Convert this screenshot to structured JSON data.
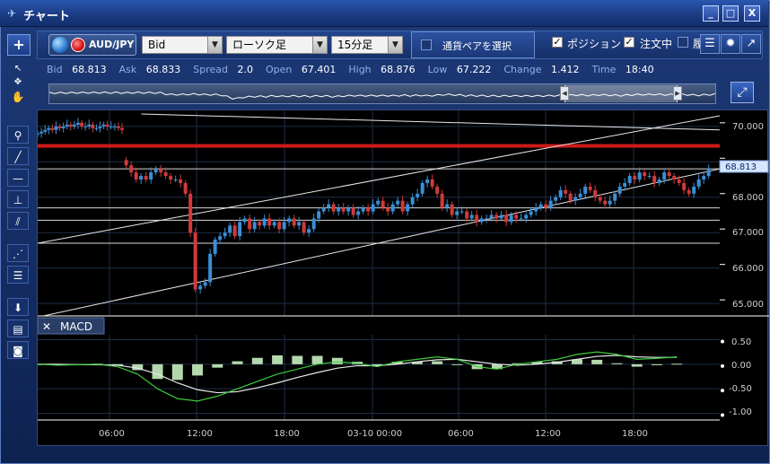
{
  "window": {
    "title": "チャート",
    "minimize_glyph": "_",
    "maximize_glyph": "□",
    "close_glyph": "X"
  },
  "toolbar": {
    "add_glyph": "+",
    "pair": "AUD/JPY",
    "price_type": "Bid",
    "chart_type": "ローソク足",
    "timeframe": "15分足",
    "pair_select_label": "通貨ペアを選択",
    "position_label": "ポジション",
    "position_checked": true,
    "orders_label": "注文中",
    "orders_checked": true,
    "history_label": "履",
    "history_checked": false
  },
  "quote": {
    "bid_label": "Bid",
    "bid": "68.813",
    "ask_label": "Ask",
    "ask": "68.833",
    "spread_label": "Spread",
    "spread": "2.0",
    "open_label": "Open",
    "open": "67.401",
    "high_label": "High",
    "high": "68.876",
    "low_label": "Low",
    "low": "67.222",
    "change_label": "Change",
    "change": "1.412",
    "time_label": "Time",
    "time": "18:40"
  },
  "colors": {
    "up": "#3a8fd6",
    "down": "#d03a3a",
    "resistance": "#cc1a1a",
    "price_label_bg": "#d6e6ff",
    "macd_line": "#3ecb3e",
    "signal_line": "#e8e8e8",
    "histogram": "#c8f0c0"
  },
  "price_axis": {
    "current_price": "68.813",
    "ticks": [
      "70.000",
      "69.000",
      "68.000",
      "67.000",
      "66.000",
      "65.000"
    ]
  },
  "macd": {
    "title": "MACD",
    "close_glyph": "✕",
    "ticks": [
      "0.50",
      "0.00",
      "-0.50",
      "-1.00"
    ]
  },
  "time_axis": {
    "ticks": [
      "06:00",
      "12:00",
      "18:00",
      "03-10 00:00",
      "06:00",
      "12:00",
      "18:00"
    ]
  },
  "chart_data": {
    "type": "candlestick",
    "pair": "AUD/JPY",
    "timeframe": "15分足",
    "price_range": [
      64.8,
      70.3
    ],
    "macd_range": [
      -1.1,
      0.6
    ],
    "time_ticks": [
      "06:00",
      "12:00",
      "18:00",
      "03-10 00:00",
      "06:00",
      "12:00",
      "18:00"
    ],
    "resistance_level": 69.45,
    "horizontal_levels": [
      68.8,
      67.7,
      67.35,
      66.7
    ],
    "channel_support": [
      [
        0.45,
        64.65
      ],
      [
        49.3,
        68.8
      ]
    ],
    "channel_resistance": [
      [
        0.0,
        66.7
      ],
      [
        49.3,
        70.3
      ]
    ],
    "trendline_top": [
      [
        7.5,
        70.35
      ],
      [
        49.3,
        69.9
      ]
    ],
    "closes": [
      69.8,
      69.85,
      69.9,
      69.95,
      69.9,
      70.0,
      69.95,
      70.0,
      70.05,
      70.0,
      70.05,
      70.1,
      70.0,
      70.0,
      70.05,
      69.95,
      69.95,
      70.0,
      70.05,
      70.0,
      70.0,
      70.0,
      69.95,
      69.9,
      68.9,
      68.7,
      68.5,
      68.6,
      68.5,
      68.7,
      68.8,
      68.7,
      68.6,
      68.5,
      68.5,
      68.4,
      68.1,
      67.0,
      65.4,
      65.5,
      65.6,
      66.4,
      66.8,
      66.9,
      67.0,
      67.2,
      66.9,
      67.3,
      67.4,
      67.1,
      67.3,
      67.2,
      67.4,
      67.2,
      67.3,
      67.1,
      67.3,
      67.4,
      67.2,
      67.3,
      67.0,
      67.1,
      67.4,
      67.6,
      67.7,
      67.8,
      67.6,
      67.7,
      67.6,
      67.7,
      67.5,
      67.6,
      67.7,
      67.6,
      67.8,
      67.9,
      67.7,
      67.6,
      67.8,
      67.9,
      67.6,
      67.8,
      68.0,
      68.1,
      68.4,
      68.5,
      68.3,
      68.1,
      67.7,
      67.8,
      67.5,
      67.6,
      67.6,
      67.4,
      67.5,
      67.3,
      67.4,
      67.4,
      67.5,
      67.4,
      67.5,
      67.3,
      67.5,
      67.4,
      67.4,
      67.5,
      67.6,
      67.7,
      67.8,
      67.7,
      67.9,
      68.0,
      68.2,
      68.1,
      67.9,
      68.0,
      68.1,
      68.3,
      68.2,
      68.0,
      67.9,
      67.8,
      67.9,
      68.1,
      68.3,
      68.4,
      68.6,
      68.5,
      68.7,
      68.6,
      68.6,
      68.4,
      68.5,
      68.7,
      68.6,
      68.5,
      68.4,
      68.2,
      68.1,
      68.3,
      68.5,
      68.6,
      68.81
    ],
    "macd_line": [
      0.0,
      -0.02,
      -0.01,
      0.0,
      -0.05,
      -0.2,
      -0.5,
      -0.7,
      -0.75,
      -0.65,
      -0.5,
      -0.35,
      -0.2,
      -0.1,
      0.0,
      0.05,
      0.02,
      -0.05,
      0.05,
      0.1,
      0.15,
      0.1,
      -0.05,
      -0.1,
      0.0,
      0.05,
      0.1,
      0.2,
      0.25,
      0.2,
      0.1,
      0.12,
      0.15
    ],
    "signal_line": [
      0.0,
      0.0,
      -0.01,
      -0.01,
      -0.02,
      -0.08,
      -0.2,
      -0.38,
      -0.52,
      -0.58,
      -0.56,
      -0.48,
      -0.38,
      -0.27,
      -0.17,
      -0.08,
      -0.03,
      -0.03,
      0.0,
      0.05,
      0.09,
      0.1,
      0.05,
      0.0,
      -0.02,
      0.0,
      0.04,
      0.1,
      0.16,
      0.18,
      0.15,
      0.14,
      0.14
    ],
    "histogram": [
      0.0,
      -0.02,
      0.0,
      0.01,
      -0.03,
      -0.12,
      -0.3,
      -0.32,
      -0.23,
      -0.07,
      0.06,
      0.13,
      0.18,
      0.17,
      0.17,
      0.13,
      0.05,
      -0.02,
      0.05,
      0.05,
      0.06,
      0.0,
      -0.1,
      -0.1,
      0.02,
      0.05,
      0.06,
      0.1,
      0.09,
      0.02,
      -0.05,
      -0.02,
      0.01
    ]
  }
}
